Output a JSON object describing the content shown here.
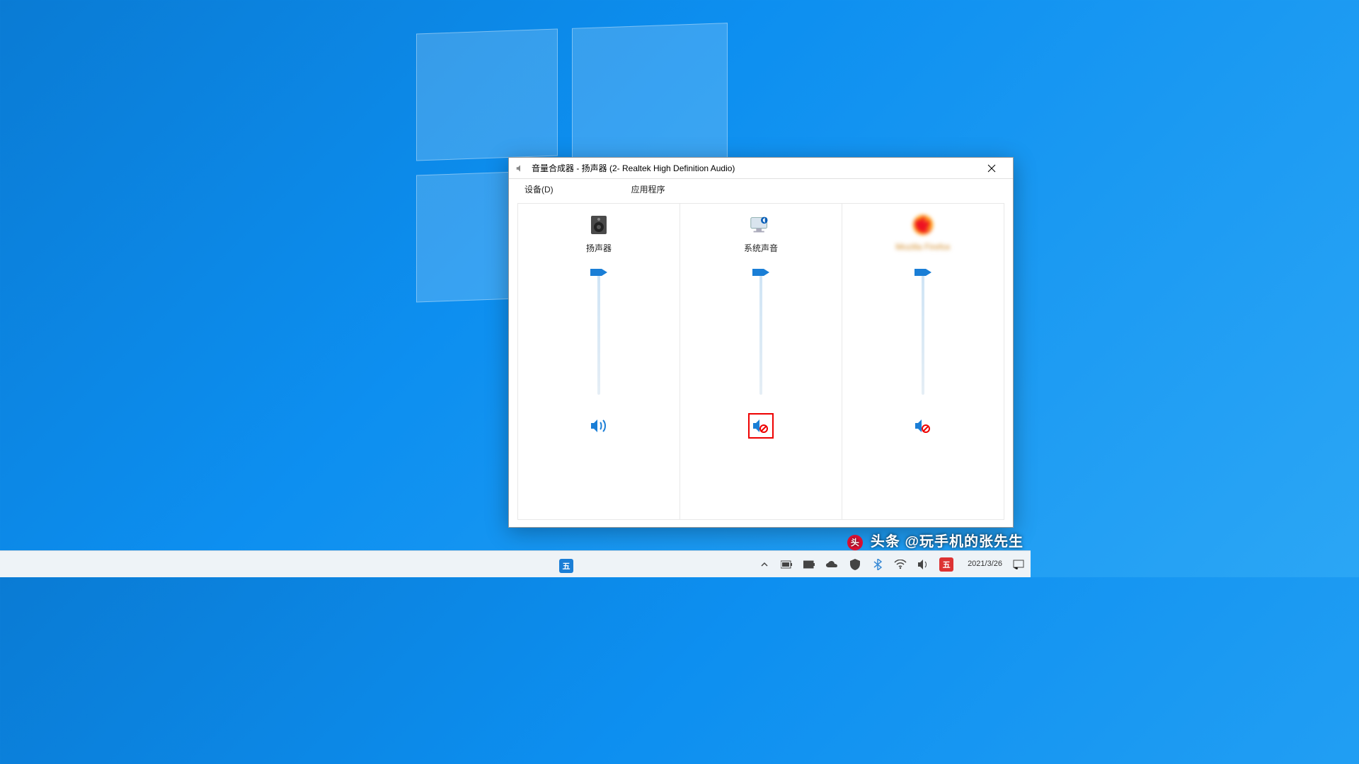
{
  "window": {
    "title": "音量合成器 - 扬声器 (2- Realtek High Definition Audio)",
    "device_label": "设备(D)",
    "apps_label": "应用程序"
  },
  "columns": [
    {
      "name": "扬声器",
      "icon": "speaker-device",
      "volume": 100,
      "muted": false,
      "highlight": false,
      "blurred": false
    },
    {
      "name": "系统声音",
      "icon": "system-sounds",
      "volume": 100,
      "muted": true,
      "highlight": true,
      "blurred": false
    },
    {
      "name": "Mozilla Firefox",
      "icon": "firefox",
      "volume": 100,
      "muted": true,
      "highlight": false,
      "blurred": true
    }
  ],
  "taskbar": {
    "ime_badge": "五",
    "date": "2021/3/26"
  },
  "watermark": {
    "prefix": "头条",
    "handle": "@玩手机的张先生"
  },
  "colors": {
    "accent": "#1a7ed6",
    "mute_red": "#e00"
  }
}
